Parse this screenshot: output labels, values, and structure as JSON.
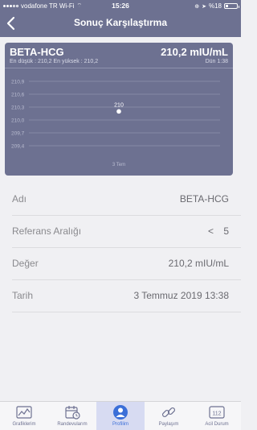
{
  "status_bar": {
    "carrier": "vodafone TR Wi-Fi",
    "time": "15:26",
    "battery": "%18"
  },
  "nav": {
    "title": "Sonuç Karşılaştırma"
  },
  "card": {
    "test_name": "BETA-HCG",
    "value": "210,2 mIU/mL",
    "range_text": "En düşük : 210,2 En yüksek : 210,2",
    "date_label": "Dün 1:38"
  },
  "chart_data": {
    "type": "scatter",
    "y_ticks": [
      "210,9",
      "210,6",
      "210,3",
      "210,0",
      "209,7",
      "209,4"
    ],
    "x_labels": [
      "3 Tem"
    ],
    "points": [
      {
        "x": "3 Tem",
        "y": 210.2,
        "label": "210"
      }
    ],
    "ylim": [
      209.4,
      210.9
    ],
    "grid": true,
    "colors": {
      "background": "#6d7191",
      "grid": "#8e92ad",
      "point": "#ffffff"
    }
  },
  "details": {
    "name_label": "Adı",
    "name_value": "BETA-HCG",
    "ref_label": "Referans Aralığı",
    "ref_operator": "<",
    "ref_value": "5",
    "value_label": "Değer",
    "value_value": "210,2 mIU/mL",
    "date_label": "Tarih",
    "date_value": "3 Temmuz 2019 13:38"
  },
  "tabs": [
    {
      "label": "Grafiklerim",
      "icon": "chart-icon"
    },
    {
      "label": "Randevularım",
      "icon": "calendar-icon"
    },
    {
      "label": "Profilim",
      "icon": "profile-icon",
      "active": true
    },
    {
      "label": "Paylaşım",
      "icon": "link-icon"
    },
    {
      "label": "Acil Durum",
      "icon": "emergency-112-icon",
      "icon_text": "112"
    }
  ],
  "colors": {
    "header": "#6d7191",
    "active_tab_bg": "#d7dbf2",
    "active_tab_text": "#3b6fd8"
  }
}
